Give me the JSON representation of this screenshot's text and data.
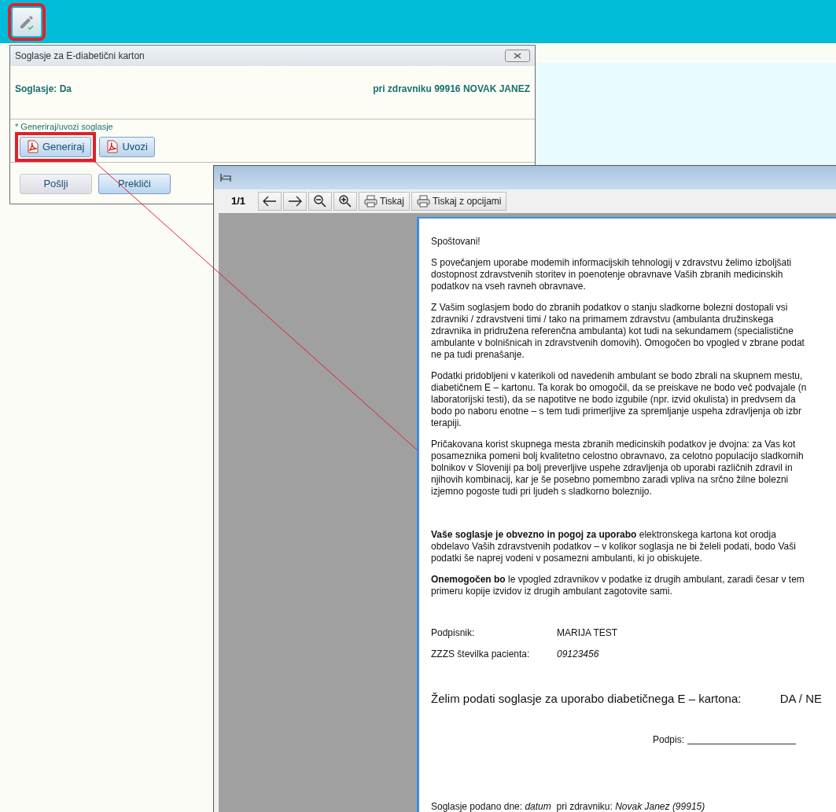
{
  "top_bar": {
    "edit_button": {
      "highlighted": true
    }
  },
  "consent_dialog": {
    "title": "Soglasje za E-diabetični karton",
    "status": "Soglasje: Da",
    "doctor": "pri zdravniku 99916 NOVAK JANEZ",
    "section_label": "* Generiraj/uvozi soglasje",
    "file_buttons": [
      {
        "label": "Generiraj",
        "highlighted": true
      },
      {
        "label": "Uvozi",
        "highlighted": false
      }
    ],
    "action_buttons": [
      {
        "label": "Pošlji",
        "kind": "plain"
      },
      {
        "label": "Prekliči",
        "kind": "primary"
      }
    ]
  },
  "viewer": {
    "page_count": "1/1",
    "print_buttons": [
      "Tiskaj",
      "Tiskaj z opcijami"
    ],
    "document": {
      "greeting": "Spoštovani!",
      "paragraphs": [
        {
          "lines": [
            "S povečanjem uporabe modemih informacijskih tehnologij v zdravstvu želimo izboljšati",
            "dostopnost zdravstvenih storitev in poenotenje obravnave Vaših zbranih medicinskih",
            "podatkov na vseh ravneh obravnave."
          ]
        },
        {
          "lines": [
            "Z Vašim soglasjem bodo do zbranih podatkov o stanju sladkorne bolezni dostopali vsi",
            "zdravniki / zdravstveni timi / tako na primamem zdravstvu (ambulanta družinskega",
            "zdravnika in pridružena referenčna ambulanta) kot tudi na sekundamem (specialistične",
            "ambulante v bolnišnicah in zdravstvenih domovih). Omogočen bo vpogled v zbrane podat",
            "ne pa tudi prenašanje."
          ]
        },
        {
          "lines": [
            "Podatki pridobljeni v katerikoli od navedenih ambulant se bodo zbrali na skupnem mestu,",
            "diabetičnem E – kartonu. Ta korak bo omogočil, da se preiskave ne bodo več podvajale (n",
            "laboratorijski testi), da se napotitve ne bodo izgubile (npr. izvid okulista) in predvsem da",
            "bodo po naboru enotne – s tem tudi primerljive za spremljanje uspeha zdravljenja ob izbr",
            "terapiji."
          ]
        },
        {
          "lines": [
            "Pričakovana korist skupnega mesta zbranih medicinskih podatkov je dvojna: za Vas kot",
            "posameznika pomeni bolj kvalitetno celostno obravnavo, za celotno populacijo sladkornih",
            "bolnikov v Sloveniji pa bolj preverljive uspehe zdravljenja ob uporabi različnih zdravil in",
            "njihovih kombinacij, kar je še posebno pomembno zaradi vpliva na srčno žilne bolezni",
            "izjemno pogoste tudi pri ljudeh s sladkorno boleznijo."
          ]
        },
        {
          "lines": [
            "**Vaše soglasje je obvezno in pogoj za uporabo** elektronskega kartona kot orodja",
            "obdelavo Vaših zdravstvenih podatkov – v kolikor soglasja ne bi želeli podati, bodo Vaši",
            "podatki še naprej vodeni v posamezni ambulanti, ki jo obiskujete."
          ]
        },
        {
          "lines": [
            "**Onemogočen bo** le vpogled zdravnikov v podatke iz drugih ambulant, zaradi česar v tem",
            "primeru kopije izvidov iz drugih ambulant zagotovite sami."
          ]
        }
      ],
      "fields": [
        {
          "label": "Podpisnik:",
          "value": "MARIJA TEST",
          "kind": "text"
        },
        {
          "label": "ZZZS številka pacienta:",
          "value": "09123456",
          "kind": "number"
        }
      ],
      "question": "Želim podati soglasje za uporabo diabetičnega E – kartona:",
      "answer": "DA / NE",
      "signature_label": "Podpis:",
      "footer": "Soglasje podano dne: *datum*  pri zdravniku: *Novak Janez (99915)*"
    }
  }
}
